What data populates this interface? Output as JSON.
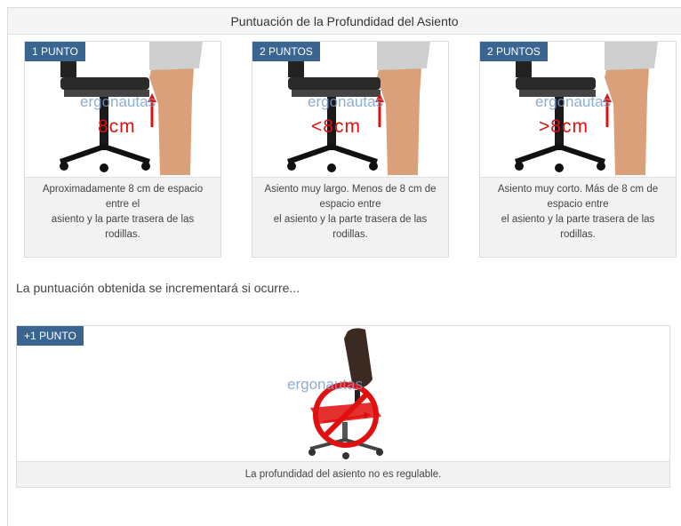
{
  "header": {
    "title": "Puntuación de la Profundidad del Asiento"
  },
  "cards": [
    {
      "badge": "1 PUNTO",
      "measure": "8cm",
      "watermark": "ergonautas",
      "caption": [
        "Aproximadamente 8 cm de espacio",
        "entre el",
        "asiento y la parte trasera de las",
        "rodillas."
      ]
    },
    {
      "badge": "2 PUNTOS",
      "measure": "<8cm",
      "watermark": "ergonautas",
      "caption": [
        "Asiento muy largo. Menos de 8 cm de",
        "espacio entre",
        "el asiento y la parte trasera de las",
        "rodillas."
      ]
    },
    {
      "badge": "2 PUNTOS",
      "measure": ">8cm",
      "watermark": "ergonautas",
      "caption": [
        "Asiento muy corto. Más de 8 cm de",
        "espacio entre",
        "el asiento y la parte trasera de las",
        "rodillas."
      ]
    }
  ],
  "increment": {
    "text": "La puntuación obtenida se incrementará si ocurre...",
    "badge": "+1 PUNTO",
    "watermark": "ergonautas",
    "caption": "La profundidad del asiento no es regulable."
  },
  "colors": {
    "badge": "#3a6590",
    "measure": "#e01010",
    "chair_seat": "#e53030"
  }
}
